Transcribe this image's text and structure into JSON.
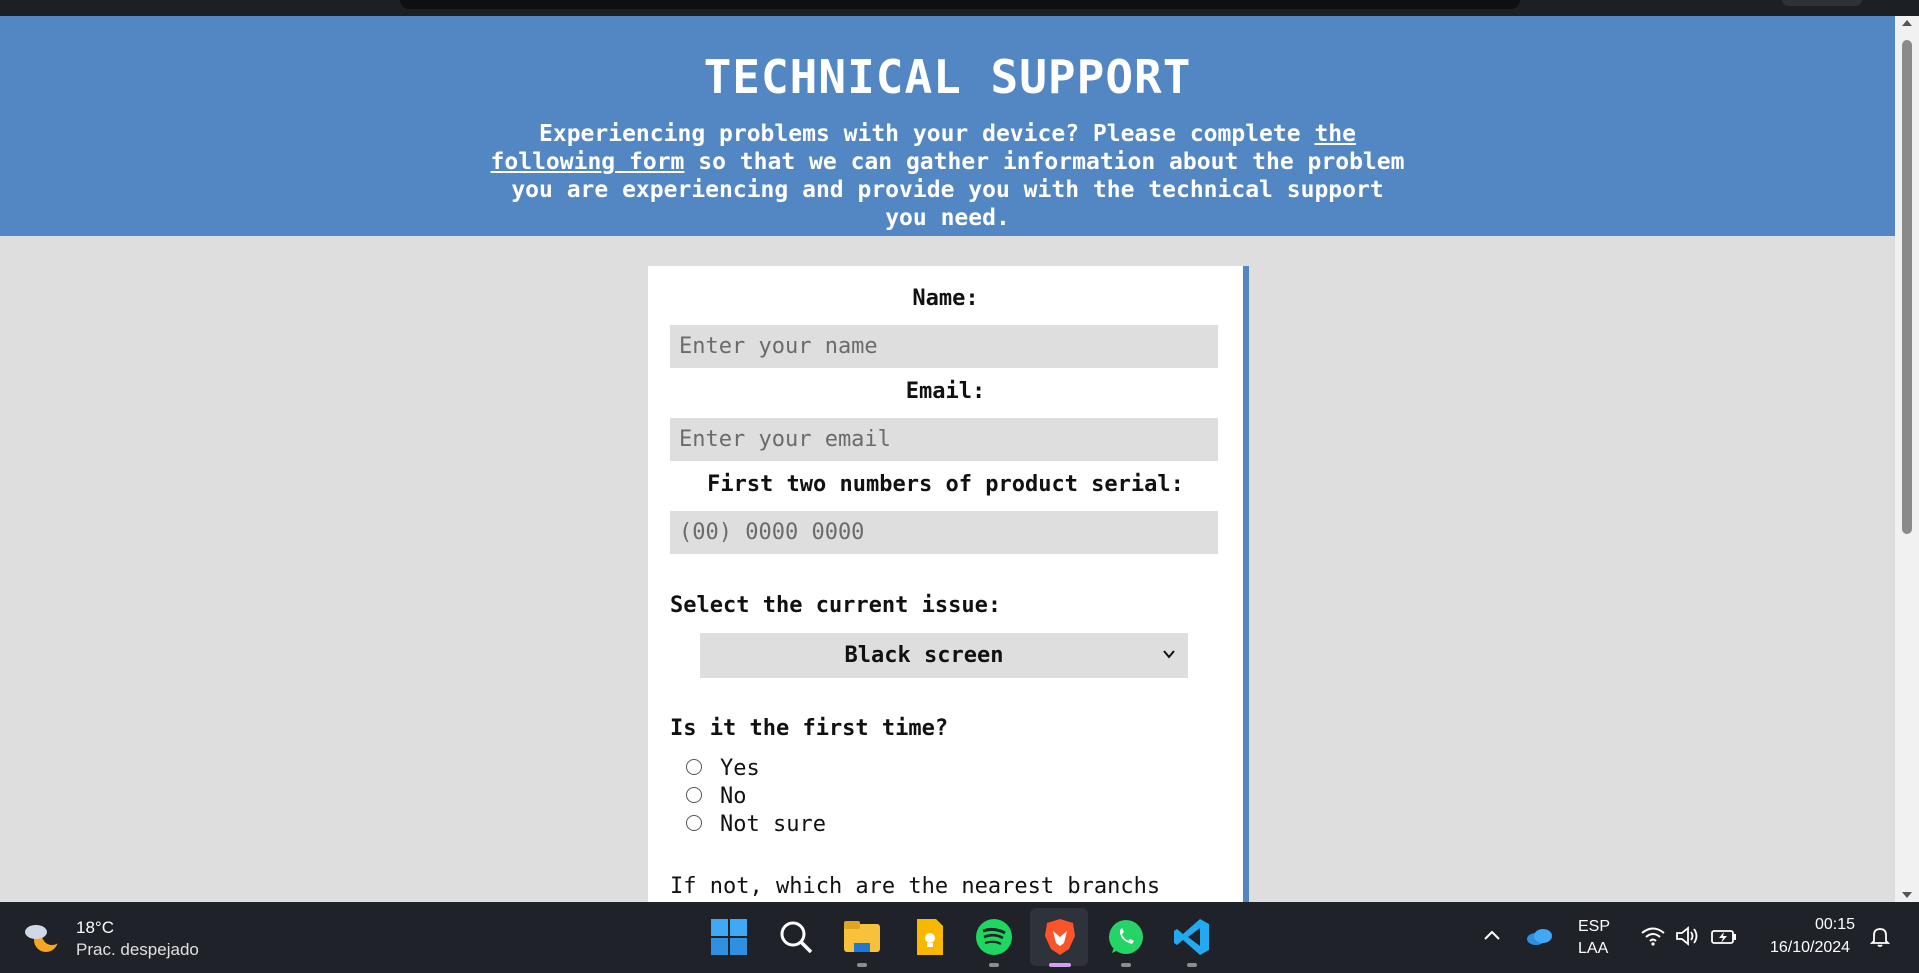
{
  "page": {
    "header": {
      "title": "TECHNICAL SUPPORT",
      "intro_before": "Experiencing problems with your device? Please complete ",
      "intro_link": "the following form",
      "intro_after": " so that we can gather information about the problem you are experiencing and provide you with the technical support you need."
    },
    "form": {
      "name_label": "Name:",
      "name_placeholder": "Enter your name",
      "email_label": "Email:",
      "email_placeholder": "Enter your email",
      "serial_label": "First two numbers of product serial:",
      "serial_placeholder": "(00) 0000 0000",
      "issue_label": "Select the current issue:",
      "issue_selected": "Black screen",
      "first_time_label": "Is it the first time?",
      "first_time_options": [
        "Yes",
        "No",
        "Not sure"
      ],
      "nearest_label": "If not, which are the nearest branchs"
    },
    "colors": {
      "header_bg": "#5287c4",
      "page_bg": "#dedede",
      "card_accent": "#5287c4"
    }
  },
  "taskbar": {
    "weather": {
      "temp": "18°C",
      "condition": "Prac. despejado"
    },
    "apps": [
      "windows-start-icon",
      "search-icon",
      "file-explorer-icon",
      "keep-notes-icon",
      "spotify-icon",
      "brave-browser-icon",
      "whatsapp-icon",
      "vscode-icon"
    ],
    "language": {
      "line1": "ESP",
      "line2": "LAA"
    },
    "clock": {
      "time": "00:15",
      "date": "16/10/2024"
    }
  }
}
